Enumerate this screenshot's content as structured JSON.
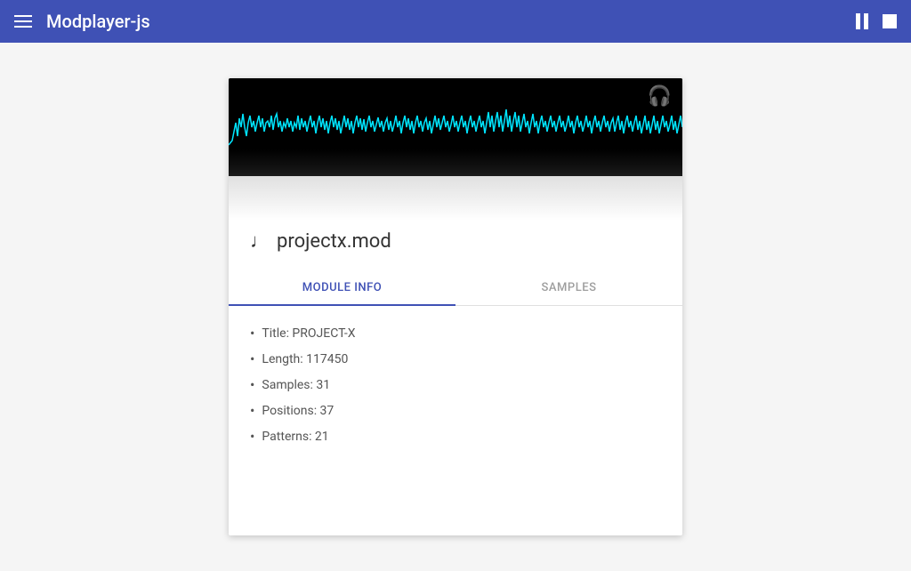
{
  "toolbar": {
    "menu_label": "Menu",
    "title": "Modplayer-js",
    "pause_label": "Pause",
    "stop_label": "Stop"
  },
  "player": {
    "song_filename": "projectx.mod",
    "waveform_color": "#00e5ff",
    "tabs": [
      {
        "id": "module-info",
        "label": "MODULE INFO",
        "active": true
      },
      {
        "id": "samples",
        "label": "SAMPLES",
        "active": false
      }
    ],
    "module_info": {
      "title_label": "Title: PROJECT-X",
      "length_label": "Length: 117450",
      "samples_label": "Samples: 31",
      "positions_label": "Positions: 37",
      "patterns_label": "Patterns: 21"
    }
  },
  "colors": {
    "accent": "#3f51b5",
    "waveform": "#00e5ff",
    "background": "#f5f5f5"
  }
}
